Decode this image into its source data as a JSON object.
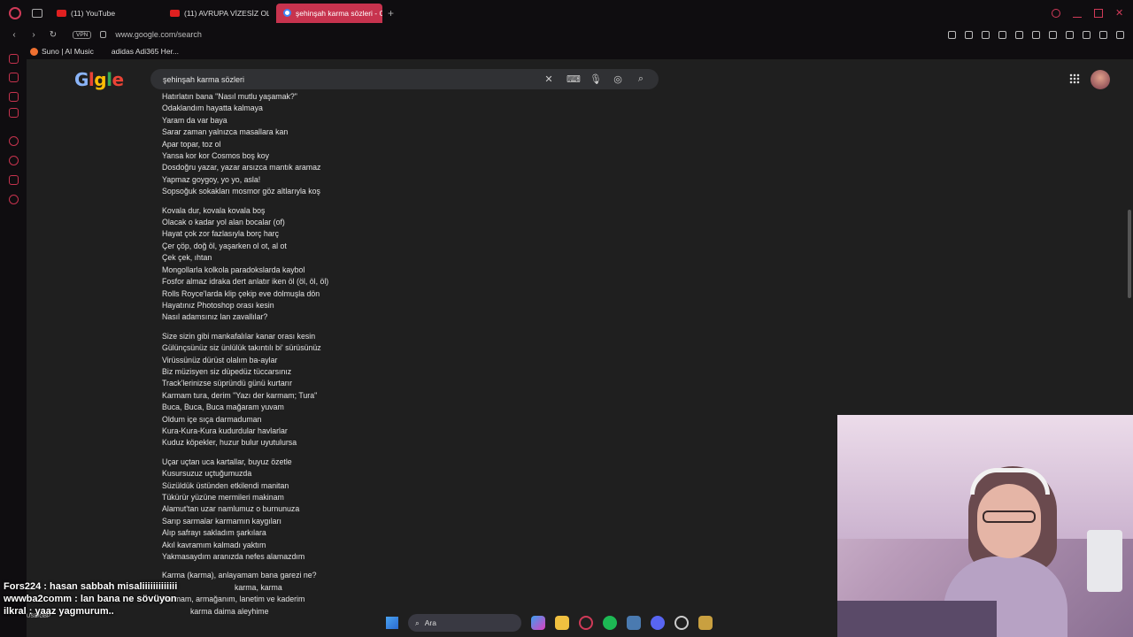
{
  "tabs": [
    {
      "label": "(11) YouTube",
      "icon": "youtube-icon",
      "active": false
    },
    {
      "label": "(11) AVRUPA VİZESİZ OLA",
      "icon": "youtube-icon",
      "active": false
    },
    {
      "label": "şehinşah karma sözleri - G",
      "icon": "google-icon",
      "active": true
    }
  ],
  "address": {
    "vpn_label": "VPN",
    "url": "www.google.com/search"
  },
  "bookmarks": [
    {
      "label": "Suno | AI Music"
    },
    {
      "label": "adidas Adi365 Her..."
    }
  ],
  "search": {
    "query": "şehinşah karma sözleri"
  },
  "lyrics": [
    [
      "Hatırlatın bana \"Nasıl mutlu yaşamak?\"",
      "Odaklandım hayatta kalmaya",
      "Yaram da var baya",
      "Sarar zaman yalnızca masallara kan",
      "Apar topar, toz ol",
      "Yansa kor kor Cosmos boş koy",
      "Dosdoğru yazar, yazar arsızca mantık aramaz",
      "Yapmaz goygoy, yo yo, asla!",
      "Sopsoğuk sokakları mosmor göz altlarıyla koş"
    ],
    [
      "Kovala dur, kovala kovala boş",
      "Olacak o kadar yol alan bocalar (of)",
      "Hayat çok zor fazlasıyla borç harç",
      "Çer çöp, doğ öl, yaşarken ol ot, al ot",
      "Çek çek, ıhtan",
      "Mongollarla kolkola paradokslarda kaybol",
      "Fosfor almaz idraka dert anlatır iken öl (öl, öl, öl)",
      "Rolls Royce'larda klip çekip eve dolmuşla dön",
      "Hayatınız Photoshop orası kesin",
      "Nasıl adamsınız lan zavallılar?"
    ],
    [
      "Size sizin gibi mankafalılar kanar orası kesin",
      "Gülünçsünüz siz ünlülük takıntılı bi' sürüsünüz",
      "Virüssünüz dürüst olalım ba-aylar",
      "Biz müzisyen siz düpedüz tüccarsınız",
      "Track'lerinizse süpründü günü kurtarır",
      "Karmam tura, derim \"Yazı der karmam; Tura\"",
      "Buca, Buca, Buca mağaram yuvam",
      "Oldum içe sıça darmaduman",
      "Kura-Kura-Kura kudurdular havlarlar",
      "Kuduz köpekler, huzur bulur uyutulursa"
    ],
    [
      "Uçar uçtan uca kartallar, buyuz özetle",
      "Kusursuzuz uçtuğumuzda",
      "Süzüldük üstünden etkilendi manitan",
      "Tükürür yüzüne mermileri makinam",
      "Alamut'tan uzar namlumuz o burnunuza",
      "Sarıp sarmalar karmamın kaygıları",
      "Alıp safrayı sakladım şarkılara",
      "Akıl kavramım kalmadı yaktım",
      "Yakmasaydım aranızda nefes alamazdım"
    ],
    [
      "Karma (karma), anlayamam bana garezi ne?",
      "karma, karma",
      "Karmam, armağanım, lanetim ve kaderim",
      "karma daima aleyhime"
    ]
  ],
  "chat": [
    {
      "user": "Fors224",
      "message": "hasan sabbah misaliiiiiiiiiiiii"
    },
    {
      "user": "wwwba2comm",
      "message": "lan bana ne sövüyon"
    },
    {
      "user": "ilkral",
      "message": "yaaz yagmurum.."
    }
  ],
  "ticker": "USD/GBP",
  "taskbar": {
    "search_label": "Ara"
  },
  "accent_color": "#c7334e"
}
